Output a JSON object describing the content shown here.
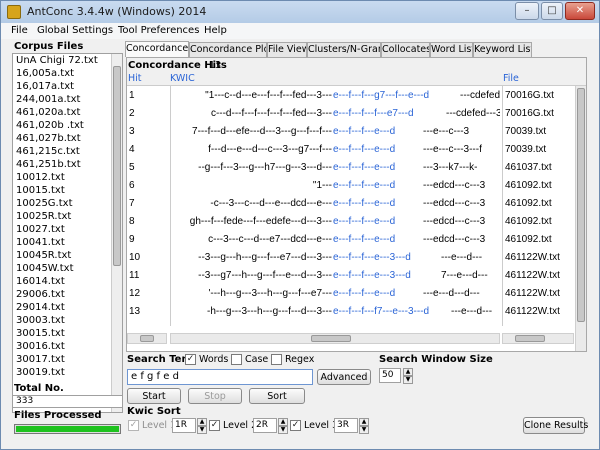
{
  "app": {
    "title": "AntConc 3.4.4w (Windows) 2014",
    "minimize": "–",
    "maximize": "□",
    "close": "✕"
  },
  "menu": [
    "File",
    "Global Settings",
    "Tool Preferences",
    "Help"
  ],
  "corpus": {
    "heading": "Corpus Files",
    "files": [
      "UnA Chigi 72.txt",
      "16,005a.txt",
      "16,017a.txt",
      "244,001a.txt",
      "461,020a.txt",
      "461,020b .txt",
      "461,027b.txt",
      "461,215c.txt",
      "461,251b.txt",
      "10012.txt",
      "10015.txt",
      "10025G.txt",
      "10025R.txt",
      "10027.txt",
      "10041.txt",
      "10045R.txt",
      "10045W.txt",
      "16014.txt",
      "29006.txt",
      "29014.txt",
      "30003.txt",
      "30015.txt",
      "30016.txt",
      "30017.txt",
      "30019.txt"
    ],
    "total_label": "Total No.",
    "total_value": "333",
    "processed_label": "Files Processed",
    "progress": 1.0
  },
  "tabs": [
    "Concordance",
    "Concordance Plot",
    "File View",
    "Clusters/N-Grams",
    "Collocates",
    "Word List",
    "Keyword List"
  ],
  "concordance": {
    "hits_label": "Concordance Hits",
    "hits_count": "13",
    "col_hit": "Hit",
    "col_kwic": "KWIC",
    "col_file": "File",
    "rows": [
      {
        "hit": "1",
        "left": "\"1---c--d---e---f---f---fed---3---",
        "kw": "e---f---f---g7---f---e---d",
        "right": "---cdefed----",
        "file": "70016G.txt"
      },
      {
        "hit": "2",
        "left": "c---d---f---f---f---f---fed---3---",
        "kw": "e---f---f---f---e7---d",
        "right": "---cdefed---3",
        "file": "70016G.txt"
      },
      {
        "hit": "3",
        "left": "7---f---d---efe---d---3---g---f---f---",
        "kw": "e---f---f---e---d",
        "right": "---e---c---3",
        "file": "70039.txt"
      },
      {
        "hit": "4",
        "left": "f---d---e---d---c---3---g7---f---",
        "kw": "e---f---f---e---d",
        "right": "---e---c---3---f",
        "file": "70039.txt"
      },
      {
        "hit": "5",
        "left": "--g---f---3---g---h7---g---3---d---",
        "kw": "e---f---f---e---d",
        "right": "---3---k7---k-",
        "file": "461037.txt"
      },
      {
        "hit": "6",
        "left": "\"1---",
        "kw": "e---f---f---e---d",
        "right": "---edcd---c---3",
        "file": "461092.txt"
      },
      {
        "hit": "7",
        "left": "-c---3---c---d---e---dcd---e---",
        "kw": "e---f---f---e---d",
        "right": "---edcd---c---3",
        "file": "461092.txt"
      },
      {
        "hit": "8",
        "left": "gh---f---fede---f---edefe---d---3---",
        "kw": "e---f---f---e---d",
        "right": "---edcd---c---3",
        "file": "461092.txt"
      },
      {
        "hit": "9",
        "left": "c---3---c---d---e7---dcd---e---",
        "kw": "e---f---f---e---d",
        "right": "---edcd---c---3",
        "file": "461092.txt"
      },
      {
        "hit": "10",
        "left": "--3---g---h---g---f---e7---d---3---",
        "kw": "e---f---f---e---3---d",
        "right": "---e---d---",
        "file": "461122W.txt"
      },
      {
        "hit": "11",
        "left": "--3---g7---h---g---f---e---d---3---",
        "kw": "e---f---f---e---3---d",
        "right": "7---e---d---",
        "file": "461122W.txt"
      },
      {
        "hit": "12",
        "left": "'---h---g---3---h---g---f---e7---",
        "kw": "e---f---f---e---d",
        "right": "---e---d---d---",
        "file": "461122W.txt"
      },
      {
        "hit": "13",
        "left": "-h---g---3---h---g---f---d---3---",
        "kw": "e---f---f---f7---e---3---d",
        "right": "---e---d---",
        "file": "461122W.txt"
      }
    ]
  },
  "search": {
    "term_label": "Search Term",
    "words_label": "Words",
    "case_label": "Case",
    "regex_label": "Regex",
    "words_checked": true,
    "case_checked": false,
    "regex_checked": false,
    "value": "e f g f e d",
    "advanced": "Advanced",
    "start": "Start",
    "stop": "Stop",
    "sort": "Sort",
    "window_label": "Search Window Size",
    "window_value": "50"
  },
  "kwic_sort": {
    "label": "Kwic Sort",
    "level1_label": "Level 1",
    "level1_value": "1R",
    "level2_label": "Level 2",
    "level2_value": "2R",
    "level3_label": "Level 3",
    "level3_value": "3R",
    "level1_checked": true,
    "level2_checked": true,
    "level3_checked": true
  },
  "clone": "Clone Results"
}
